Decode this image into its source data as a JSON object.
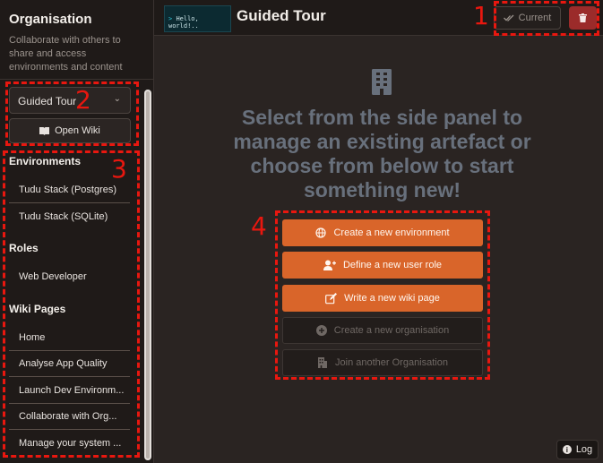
{
  "sidebar": {
    "org_title": "Organisation",
    "org_description": "Collaborate with others to share and access environments and content",
    "selected_wiki": "Guided Tour",
    "open_wiki_label": "Open Wiki",
    "sections": [
      {
        "title": "Environments",
        "items": [
          "Tudu Stack (Postgres)",
          "Tudu Stack (SQLite)"
        ]
      },
      {
        "title": "Roles",
        "items": [
          "Web Developer"
        ]
      },
      {
        "title": "Wiki Pages",
        "items": [
          "Home",
          "Analyse App Quality",
          "Launch Dev Environm...",
          "Collaborate with Org...",
          "Manage your system ..."
        ]
      }
    ]
  },
  "header": {
    "thumbnail_text": "Hello, world!..",
    "title": "Guided Tour",
    "current_label": "Current"
  },
  "main": {
    "headline": "Select from the side panel to manage an existing artefact or choose from below to start something new!",
    "actions": [
      {
        "label": "Create a new environment",
        "style": "primary",
        "icon": "globe-icon"
      },
      {
        "label": "Define a new user role",
        "style": "primary",
        "icon": "user-plus-icon"
      },
      {
        "label": "Write a new wiki page",
        "style": "primary",
        "icon": "edit-icon"
      },
      {
        "label": "Create a new organisation",
        "style": "secondary",
        "icon": "plus-circle-icon"
      },
      {
        "label": "Join another Organisation",
        "style": "secondary",
        "icon": "building-icon"
      }
    ]
  },
  "log_label": "Log",
  "annotations": [
    "1",
    "2",
    "3",
    "4"
  ],
  "colors": {
    "accent": "#d9652a",
    "danger": "#9b2b2a",
    "annotation": "#e8170f",
    "background": "#2a2422",
    "sidebar": "#1f1a18"
  }
}
